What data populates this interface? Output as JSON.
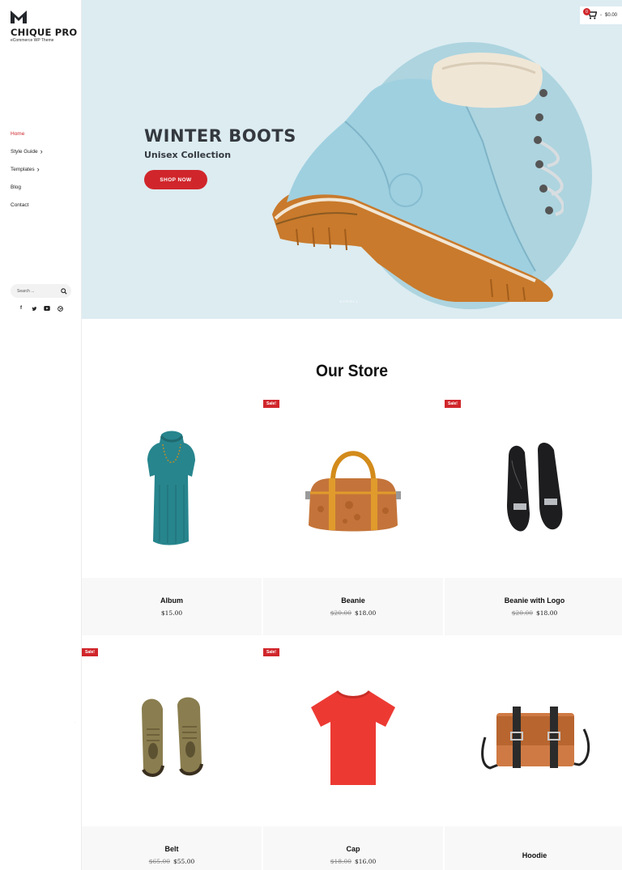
{
  "brand": {
    "name": "CHIQUE PRO",
    "tagline": "eCommerce WP Theme"
  },
  "nav": [
    {
      "label": "Home",
      "active": true,
      "has_children": false
    },
    {
      "label": "Style Guide",
      "active": false,
      "has_children": true
    },
    {
      "label": "Templates",
      "active": false,
      "has_children": true
    },
    {
      "label": "Blog",
      "active": false,
      "has_children": false
    },
    {
      "label": "Contact",
      "active": false,
      "has_children": false
    }
  ],
  "search": {
    "placeholder": "Search ..."
  },
  "socials": [
    "facebook-icon",
    "twitter-icon",
    "youtube-icon",
    "dribbble-icon"
  ],
  "cart": {
    "count": "0",
    "separator": "-",
    "total": "$0.00"
  },
  "hero": {
    "title": "WINTER BOOTS",
    "subtitle": "Unisex Collection",
    "button": "SHOP NOW",
    "scroll_hint": "SCROLL"
  },
  "store": {
    "title": "Our Store",
    "sale_label": "Sale!",
    "products": [
      {
        "name": "Album",
        "price": "$15.00",
        "old_price": "",
        "sale": false,
        "image": "dress"
      },
      {
        "name": "Beanie",
        "price": "$18.00",
        "old_price": "$20.00",
        "sale": true,
        "image": "handbag"
      },
      {
        "name": "Beanie with Logo",
        "price": "$18.00",
        "old_price": "$20.00",
        "sale": true,
        "image": "heels"
      },
      {
        "name": "Belt",
        "price": "$55.00",
        "old_price": "$65.00",
        "sale": true,
        "image": "shoes"
      },
      {
        "name": "Cap",
        "price": "$16.00",
        "old_price": "$18.00",
        "sale": true,
        "image": "tshirt"
      },
      {
        "name": "Hoodie",
        "price": "",
        "old_price": "",
        "sale": false,
        "image": "messenger-bag"
      }
    ]
  },
  "colors": {
    "accent": "#d0262b",
    "hero_bg": "#dcecf1",
    "hero_circle": "#add4df",
    "card_bg": "#f8f8f9"
  }
}
